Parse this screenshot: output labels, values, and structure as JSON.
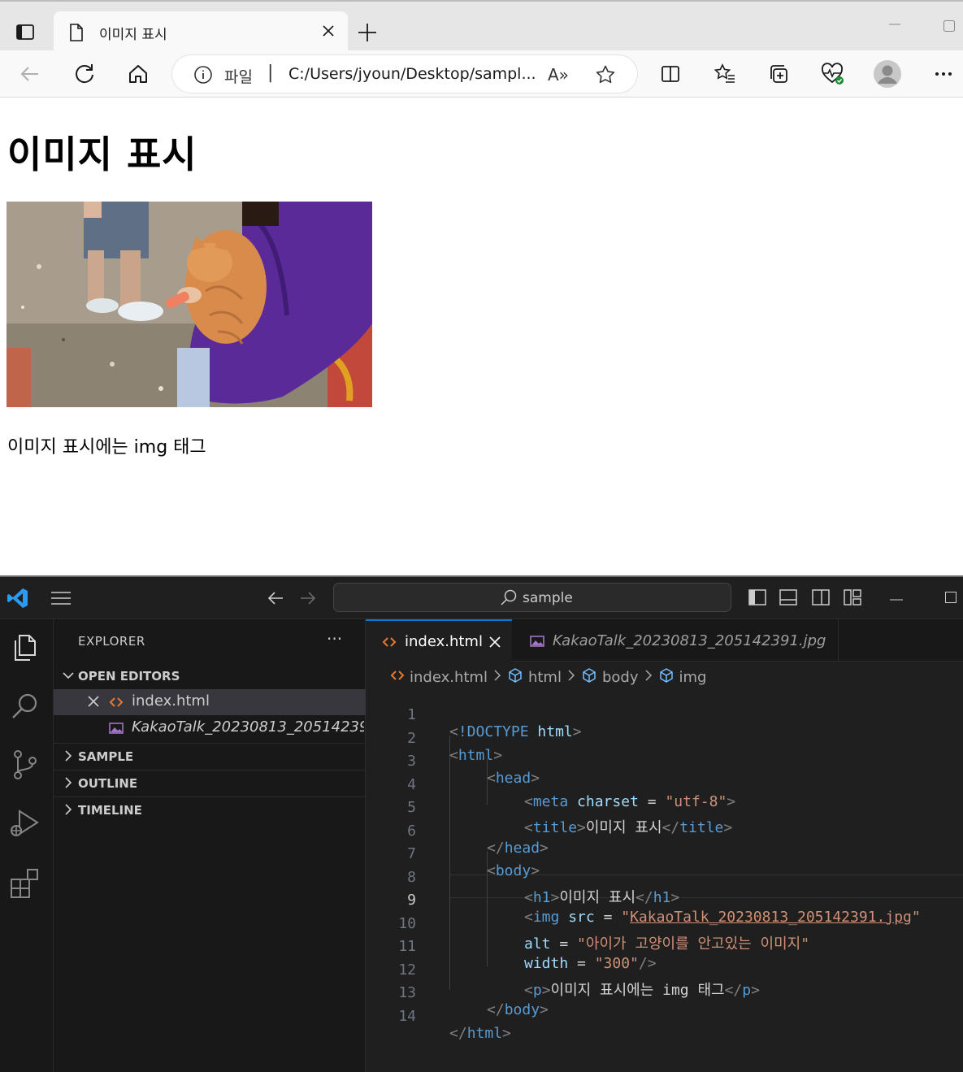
{
  "browser": {
    "tab_title": "이미지 표시",
    "address_scheme": "파일",
    "address_url": "C:/Users/jyoun/Desktop/sampl...",
    "read_aloud": "A»"
  },
  "page": {
    "heading": "이미지 표시",
    "paragraph": "이미지 표시에는 img 태그"
  },
  "vscode": {
    "search_label": "sample",
    "explorer_title": "EXPLORER",
    "more": "···",
    "sections": {
      "open_editors": "OPEN EDITORS",
      "sample": "SAMPLE",
      "outline": "OUTLINE",
      "timeline": "TIMELINE"
    },
    "open_files": [
      "index.html",
      "KakaoTalk_20230813_20514239..."
    ],
    "tabs": [
      "index.html",
      "KakaoTalk_20230813_205142391.jpg"
    ],
    "breadcrumb": [
      "index.html",
      "html",
      "body",
      "img"
    ],
    "line_numbers": [
      "1",
      "2",
      "3",
      "4",
      "5",
      "6",
      "7",
      "8",
      "9",
      "10",
      "11",
      "12",
      "13",
      "14"
    ],
    "code": {
      "l1_doctype": "!DOCTYPE",
      "l1_html": "html",
      "l2_tag": "html",
      "l3_tag": "head",
      "l4_tag": "meta",
      "l4_attr": "charset",
      "l4_val": "\"utf-8\"",
      "l5_tag": "title",
      "l5_text": "이미지 표시",
      "l6_tag": "head",
      "l7_tag": "body",
      "l8_tag": "h1",
      "l8_text": "이미지 표시",
      "l9_tag": "img",
      "l9_attr": "src",
      "l9_val": "KakaoTalk_20230813_205142391.jpg",
      "l10_attr": "alt",
      "l10_val": "\"아이가 고양이를 안고있는 이미지\"",
      "l11_attr": "width",
      "l11_val": "\"300\"",
      "l12_tag": "p",
      "l12_text": "이미지 표시에는 img 태그",
      "l13_tag": "body",
      "l14_tag": "html"
    }
  }
}
